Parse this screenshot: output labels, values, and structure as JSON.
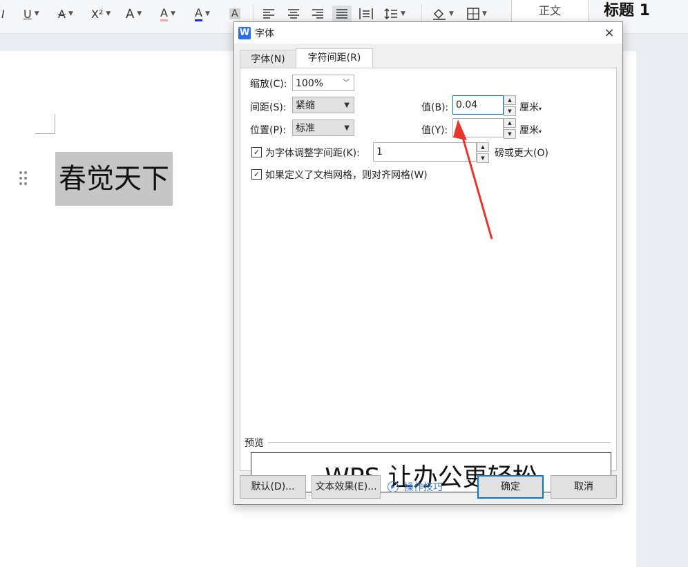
{
  "toolbar": {
    "italic": "I",
    "underline": "U",
    "strike": "A",
    "superscript": "X²",
    "outline": "A",
    "highlight": "A",
    "fontcolor": "A",
    "charshade": "A",
    "style_zw": "正文",
    "style_h1": "标题 1"
  },
  "document": {
    "text": "春觉天下"
  },
  "dialog": {
    "title": "字体",
    "app_icon": "W",
    "close": "×",
    "tabs": [
      {
        "label": "字体(N)"
      },
      {
        "label": "字符间距(R)"
      }
    ],
    "scale": {
      "label": "缩放(C):",
      "value": "100%"
    },
    "spacing": {
      "label": "间距(S):",
      "value": "紧缩",
      "value_label": "值(B):",
      "amount": "0.04",
      "unit": "厘米"
    },
    "position": {
      "label": "位置(P):",
      "value": "标准",
      "value_label": "值(Y):",
      "amount": "",
      "unit": "厘米"
    },
    "kerning": {
      "label": "为字体调整字间距(K):",
      "value": "1",
      "suffix": "磅或更大(O)"
    },
    "grid": {
      "label": "如果定义了文档网格，则对齐网格(W)"
    },
    "preview": {
      "label": "预览",
      "text": "WPS 让办公更轻松"
    },
    "buttons": {
      "default": "默认(D)...",
      "text_effects": "文本效果(E)...",
      "tips": "操作技巧",
      "ok": "确定",
      "cancel": "取消"
    }
  },
  "colors": {
    "accent": "#0078d7",
    "arrow": "#e8352e",
    "tips": "#3a7bd5"
  }
}
